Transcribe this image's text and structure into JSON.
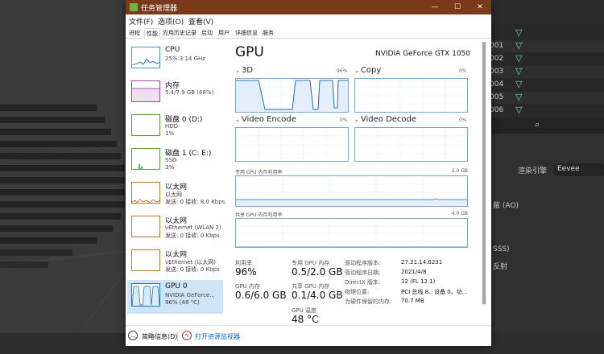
{
  "window": {
    "title": "任务管理器",
    "controls": {
      "minimize": "—",
      "maximize": "☐",
      "close": "✕"
    }
  },
  "menu": [
    "文件(F)",
    "选项(O)",
    "查看(V)"
  ],
  "tabs": [
    "进程",
    "性能",
    "应用历史记录",
    "启动",
    "用户",
    "详细信息",
    "服务"
  ],
  "active_tab": "性能",
  "sidebar": [
    {
      "name": "CPU",
      "sub1": "25%  3.14 GHz",
      "sub2": ""
    },
    {
      "name": "内存",
      "sub1": "5.4/7.9 GB (68%)",
      "sub2": ""
    },
    {
      "name": "磁盘 0 (D:)",
      "sub1": "HDD",
      "sub2": "1%"
    },
    {
      "name": "磁盘 1 (C: E:)",
      "sub1": "SSD",
      "sub2": "3%"
    },
    {
      "name": "以太网",
      "sub1": "以太网",
      "sub2": "发送: 0 接收: 8.0 Kbps"
    },
    {
      "name": "以太网",
      "sub1": "vEthernet (WLAN 2)",
      "sub2": "发送: 0 接收: 0 Kbps"
    },
    {
      "name": "以太网",
      "sub1": "vEthernet (以太网)",
      "sub2": "发送: 0 接收: 0 Kbps"
    },
    {
      "name": "GPU 0",
      "sub1": "NVIDIA GeForce...",
      "sub2": "96% (48 °C)"
    }
  ],
  "gpu": {
    "title": "GPU",
    "model": "NVIDIA GeForce GTX 1050",
    "engines": [
      {
        "label": "3D",
        "pct": "96%"
      },
      {
        "label": "Copy",
        "pct": "0%"
      },
      {
        "label": "Video Encode",
        "pct": "0%"
      },
      {
        "label": "Video Decode",
        "pct": "0%"
      }
    ],
    "dedicated_label": "专用 GPU 内存利用率",
    "dedicated_max": "2.0 GB",
    "shared_label": "共享 GPU 内存利用率",
    "shared_max": "4.0 GB"
  },
  "stats": {
    "util_label": "利用率",
    "util_value": "96%",
    "dedicated_label": "专用 GPU 内存",
    "dedicated_value": "0.5/2.0 GB",
    "gpu_mem_label": "GPU 内存",
    "gpu_mem_value": "0.6/6.0 GB",
    "shared_label": "共享 GPU 内存",
    "shared_value": "0.1/4.0 GB",
    "temp_label": "GPU 温度",
    "temp_value": "48 °C"
  },
  "info": [
    {
      "label": "驱动程序版本:",
      "value": "27.21.14.6231"
    },
    {
      "label": "驱动程序日期:",
      "value": "2021/4/8"
    },
    {
      "label": "DirectX 版本:",
      "value": "12 (FL 12.1)"
    },
    {
      "label": "物理位置:",
      "value": "PCI 总线 8、设备 0、功..."
    },
    {
      "label": "为硬件保留的内存:",
      "value": "70.7 MB"
    }
  ],
  "footer": {
    "less": "简略信息(D)",
    "monitor": "打开资源监视器"
  },
  "background": {
    "outliner_nums": [
      "001",
      "002",
      "003",
      "004",
      "005",
      "006"
    ],
    "engine_label": "渲染引擎",
    "engine_value": "Eevee",
    "labels": [
      "蔽 (AO)",
      "SSS)",
      "反射"
    ]
  },
  "colors": {
    "accent": "#1f6fb2",
    "titlebar": "#7a3a1a",
    "graph_border": "#7fa7c9"
  }
}
